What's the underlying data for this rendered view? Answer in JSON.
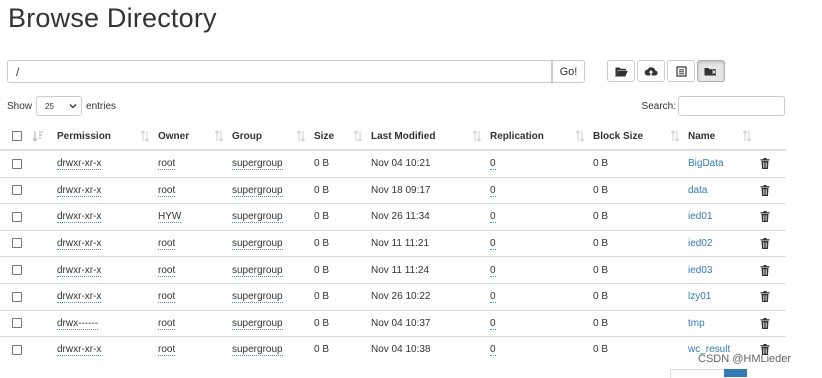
{
  "page": {
    "title": "Browse Directory"
  },
  "pathbar": {
    "value": "/",
    "go_label": "Go!"
  },
  "toolbar": [
    {
      "name": "create-directory-button",
      "icon": "folder-open-icon"
    },
    {
      "name": "upload-button",
      "icon": "cloud-upload-icon"
    },
    {
      "name": "list-view-button",
      "icon": "list-icon"
    },
    {
      "name": "cut-paste-button",
      "icon": "folder-cut-icon",
      "active": true
    }
  ],
  "table_controls": {
    "show_label": "Show",
    "entries_value": "25",
    "entries_label": "entries",
    "search_label": "Search:"
  },
  "columns": [
    "Permission",
    "Owner",
    "Group",
    "Size",
    "Last Modified",
    "Replication",
    "Block Size",
    "Name"
  ],
  "rows": [
    {
      "permission": "drwxr-xr-x",
      "owner": "root",
      "group": "supergroup",
      "size": "0 B",
      "modified": "Nov 04 10:21",
      "replication": "0",
      "block_size": "0 B",
      "name": "BigData"
    },
    {
      "permission": "drwxr-xr-x",
      "owner": "root",
      "group": "supergroup",
      "size": "0 B",
      "modified": "Nov 18 09:17",
      "replication": "0",
      "block_size": "0 B",
      "name": "data"
    },
    {
      "permission": "drwxr-xr-x",
      "owner": "HYW",
      "group": "supergroup",
      "size": "0 B",
      "modified": "Nov 26 11:34",
      "replication": "0",
      "block_size": "0 B",
      "name": "ied01"
    },
    {
      "permission": "drwxr-xr-x",
      "owner": "root",
      "group": "supergroup",
      "size": "0 B",
      "modified": "Nov 11 11:21",
      "replication": "0",
      "block_size": "0 B",
      "name": "ied02"
    },
    {
      "permission": "drwxr-xr-x",
      "owner": "root",
      "group": "supergroup",
      "size": "0 B",
      "modified": "Nov 11 11:24",
      "replication": "0",
      "block_size": "0 B",
      "name": "ied03"
    },
    {
      "permission": "drwxr-xr-x",
      "owner": "root",
      "group": "supergroup",
      "size": "0 B",
      "modified": "Nov 26 10:22",
      "replication": "0",
      "block_size": "0 B",
      "name": "lzy01"
    },
    {
      "permission": "drwx------",
      "owner": "root",
      "group": "supergroup",
      "size": "0 B",
      "modified": "Nov 04 10:37",
      "replication": "0",
      "block_size": "0 B",
      "name": "tmp"
    },
    {
      "permission": "drwxr-xr-x",
      "owner": "root",
      "group": "supergroup",
      "size": "0 B",
      "modified": "Nov 04 10:38",
      "replication": "0",
      "block_size": "0 B",
      "name": "wc_result"
    }
  ],
  "watermark": "CSDN @HMLieder",
  "colors": {
    "link": "#337ab7",
    "border": "#dddddd",
    "active_page": "#337ab7"
  }
}
